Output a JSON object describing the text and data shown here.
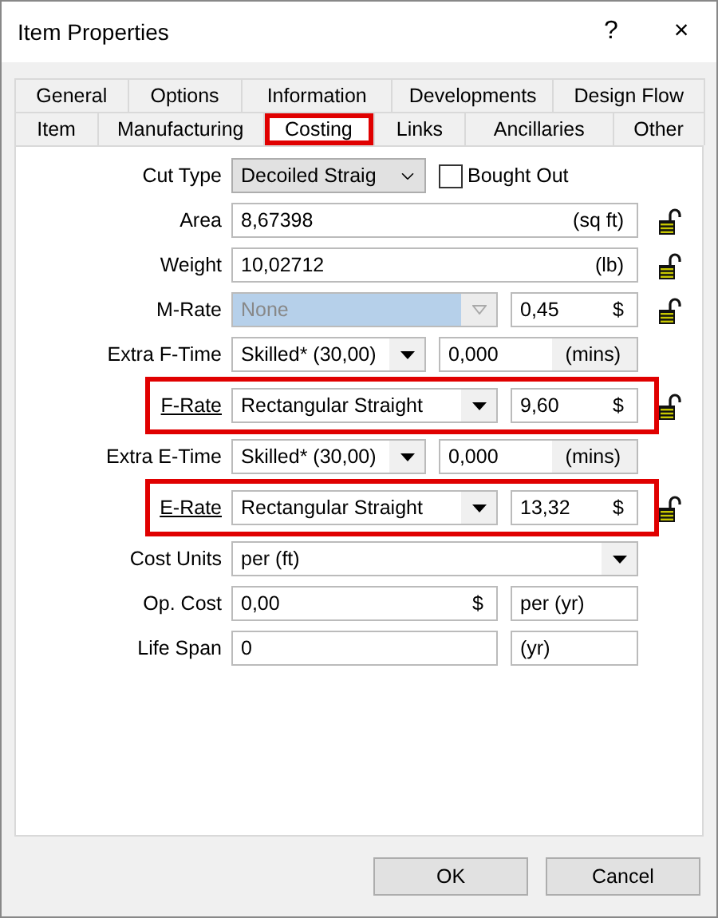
{
  "window": {
    "title": "Item Properties",
    "help": "?",
    "close": "×"
  },
  "tabs": {
    "back": [
      {
        "label": "General",
        "selected": false,
        "highlighted": false
      },
      {
        "label": "Options",
        "selected": false,
        "highlighted": false
      },
      {
        "label": "Information",
        "selected": false,
        "highlighted": false
      },
      {
        "label": "Developments",
        "selected": false,
        "highlighted": false
      },
      {
        "label": "Design Flow",
        "selected": false,
        "highlighted": false
      }
    ],
    "front": [
      {
        "label": "Item",
        "selected": false,
        "highlighted": false
      },
      {
        "label": "Manufacturing",
        "selected": false,
        "highlighted": false
      },
      {
        "label": "Costing",
        "selected": true,
        "highlighted": true
      },
      {
        "label": "Links",
        "selected": false,
        "highlighted": false
      },
      {
        "label": "Ancillaries",
        "selected": false,
        "highlighted": false
      },
      {
        "label": "Other",
        "selected": false,
        "highlighted": false
      }
    ]
  },
  "rows": [
    {
      "kind": "combo_check",
      "label": "Cut Type",
      "link": false,
      "highlighted": false,
      "lock": false,
      "value": "Decoiled Straig",
      "checkbox": {
        "label": "Bought Out",
        "checked": false
      }
    },
    {
      "kind": "text",
      "label": "Area",
      "link": false,
      "highlighted": false,
      "lock": true,
      "value": "8,67398",
      "unit": "(sq ft)"
    },
    {
      "kind": "text",
      "label": "Weight",
      "link": false,
      "highlighted": false,
      "lock": true,
      "value": "10,02712",
      "unit": "(lb)"
    },
    {
      "kind": "rate",
      "label": "M-Rate",
      "link": false,
      "highlighted": false,
      "lock": true,
      "value": "None",
      "disabled": true,
      "amount": "0,45",
      "currency": "$"
    },
    {
      "kind": "time",
      "label": "Extra F-Time",
      "link": false,
      "highlighted": false,
      "lock": false,
      "value": "Skilled* (30,00)",
      "amount": "0,000",
      "unit": "(mins)"
    },
    {
      "kind": "rate",
      "label": "F-Rate",
      "link": true,
      "highlighted": true,
      "lock": true,
      "value": "Rectangular Straight",
      "disabled": false,
      "amount": "9,60",
      "currency": "$"
    },
    {
      "kind": "time",
      "label": "Extra E-Time",
      "link": false,
      "highlighted": false,
      "lock": false,
      "value": "Skilled* (30,00)",
      "amount": "0,000",
      "unit": "(mins)"
    },
    {
      "kind": "rate",
      "label": "E-Rate",
      "link": true,
      "highlighted": true,
      "lock": true,
      "value": "Rectangular Straight",
      "disabled": false,
      "amount": "13,32",
      "currency": "$"
    },
    {
      "kind": "wide_combo",
      "label": "Cost Units",
      "link": false,
      "highlighted": false,
      "lock": false,
      "value": "per (ft)"
    },
    {
      "kind": "pair",
      "label": "Op. Cost",
      "link": false,
      "highlighted": false,
      "lock": false,
      "value": "0,00",
      "unit": "$",
      "second": "per (yr)"
    },
    {
      "kind": "pair",
      "label": "Life Span",
      "link": false,
      "highlighted": false,
      "lock": false,
      "value": "0",
      "second": "(yr)"
    }
  ],
  "buttons": [
    "OK",
    "Cancel"
  ]
}
